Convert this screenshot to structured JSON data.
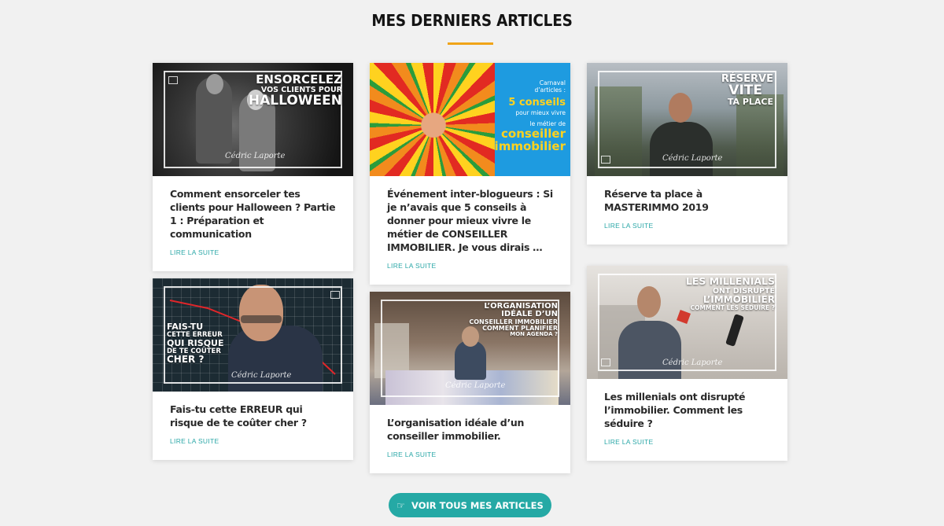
{
  "section": {
    "title": "MES DERNIERS ARTICLES"
  },
  "articles": [
    {
      "title": "Comment ensorceler tes clients pour Halloween ? Partie 1 : Préparation et communication",
      "read_more": "LIRE LA SUITE",
      "thumb_text": [
        "ENSORCELEZ",
        "VOS CLIENTS POUR",
        "HALLOWEEN"
      ],
      "signature": "Cédric Laporte"
    },
    {
      "title": "Événement inter-blogueurs : Si je n’avais que 5 conseils à donner pour mieux vivre le métier de CONSEILLER IMMOBILIER. Je vous dirais …",
      "read_more": "LIRE LA SUITE",
      "thumb_text": [
        "Carnaval",
        "d’articles :",
        "5 conseils",
        "pour mieux vivre",
        "le métier de",
        "conseiller",
        "immobilier"
      ]
    },
    {
      "title": "Réserve ta place à MASTERIMMO 2019",
      "read_more": "LIRE LA SUITE",
      "thumb_text": [
        "RÉSERVE",
        "VITE",
        "TA PLACE"
      ],
      "signature": "Cédric Laporte"
    },
    {
      "title": "Fais-tu cette ERREUR qui risque de te coûter cher ?",
      "read_more": "LIRE LA SUITE",
      "thumb_text": [
        "FAIS-TU",
        "CETTE ERREUR",
        "QUI RISQUE",
        "DE TE COÛTER",
        "CHER ?"
      ],
      "signature": "Cédric Laporte"
    },
    {
      "title": "L’organisation idéale d’un conseiller immobilier.",
      "read_more": "LIRE LA SUITE",
      "thumb_text": [
        "L’ORGANISATION",
        "IDÉALE D’UN",
        "CONSEILLER IMMOBILIER",
        "COMMENT PLANIFIER",
        "MON AGENDA ?"
      ],
      "signature": "Cédric Laporte"
    },
    {
      "title": "Les millenials ont disrupté l’immobilier. Comment les séduire ?",
      "read_more": "LIRE LA SUITE",
      "thumb_text": [
        "LES MILLENIALS",
        "ONT DISRUPTÉ",
        "L’IMMOBILIER",
        "COMMENT LES SÉDUIRE ?"
      ],
      "signature": "Cédric Laporte"
    }
  ],
  "cta": {
    "label": "VOIR TOUS MES ARTICLES",
    "icon": "hand-pointer-icon"
  },
  "colors": {
    "accent": "#f0a418",
    "teal": "#25a9a5",
    "link": "#2aa7a7"
  }
}
